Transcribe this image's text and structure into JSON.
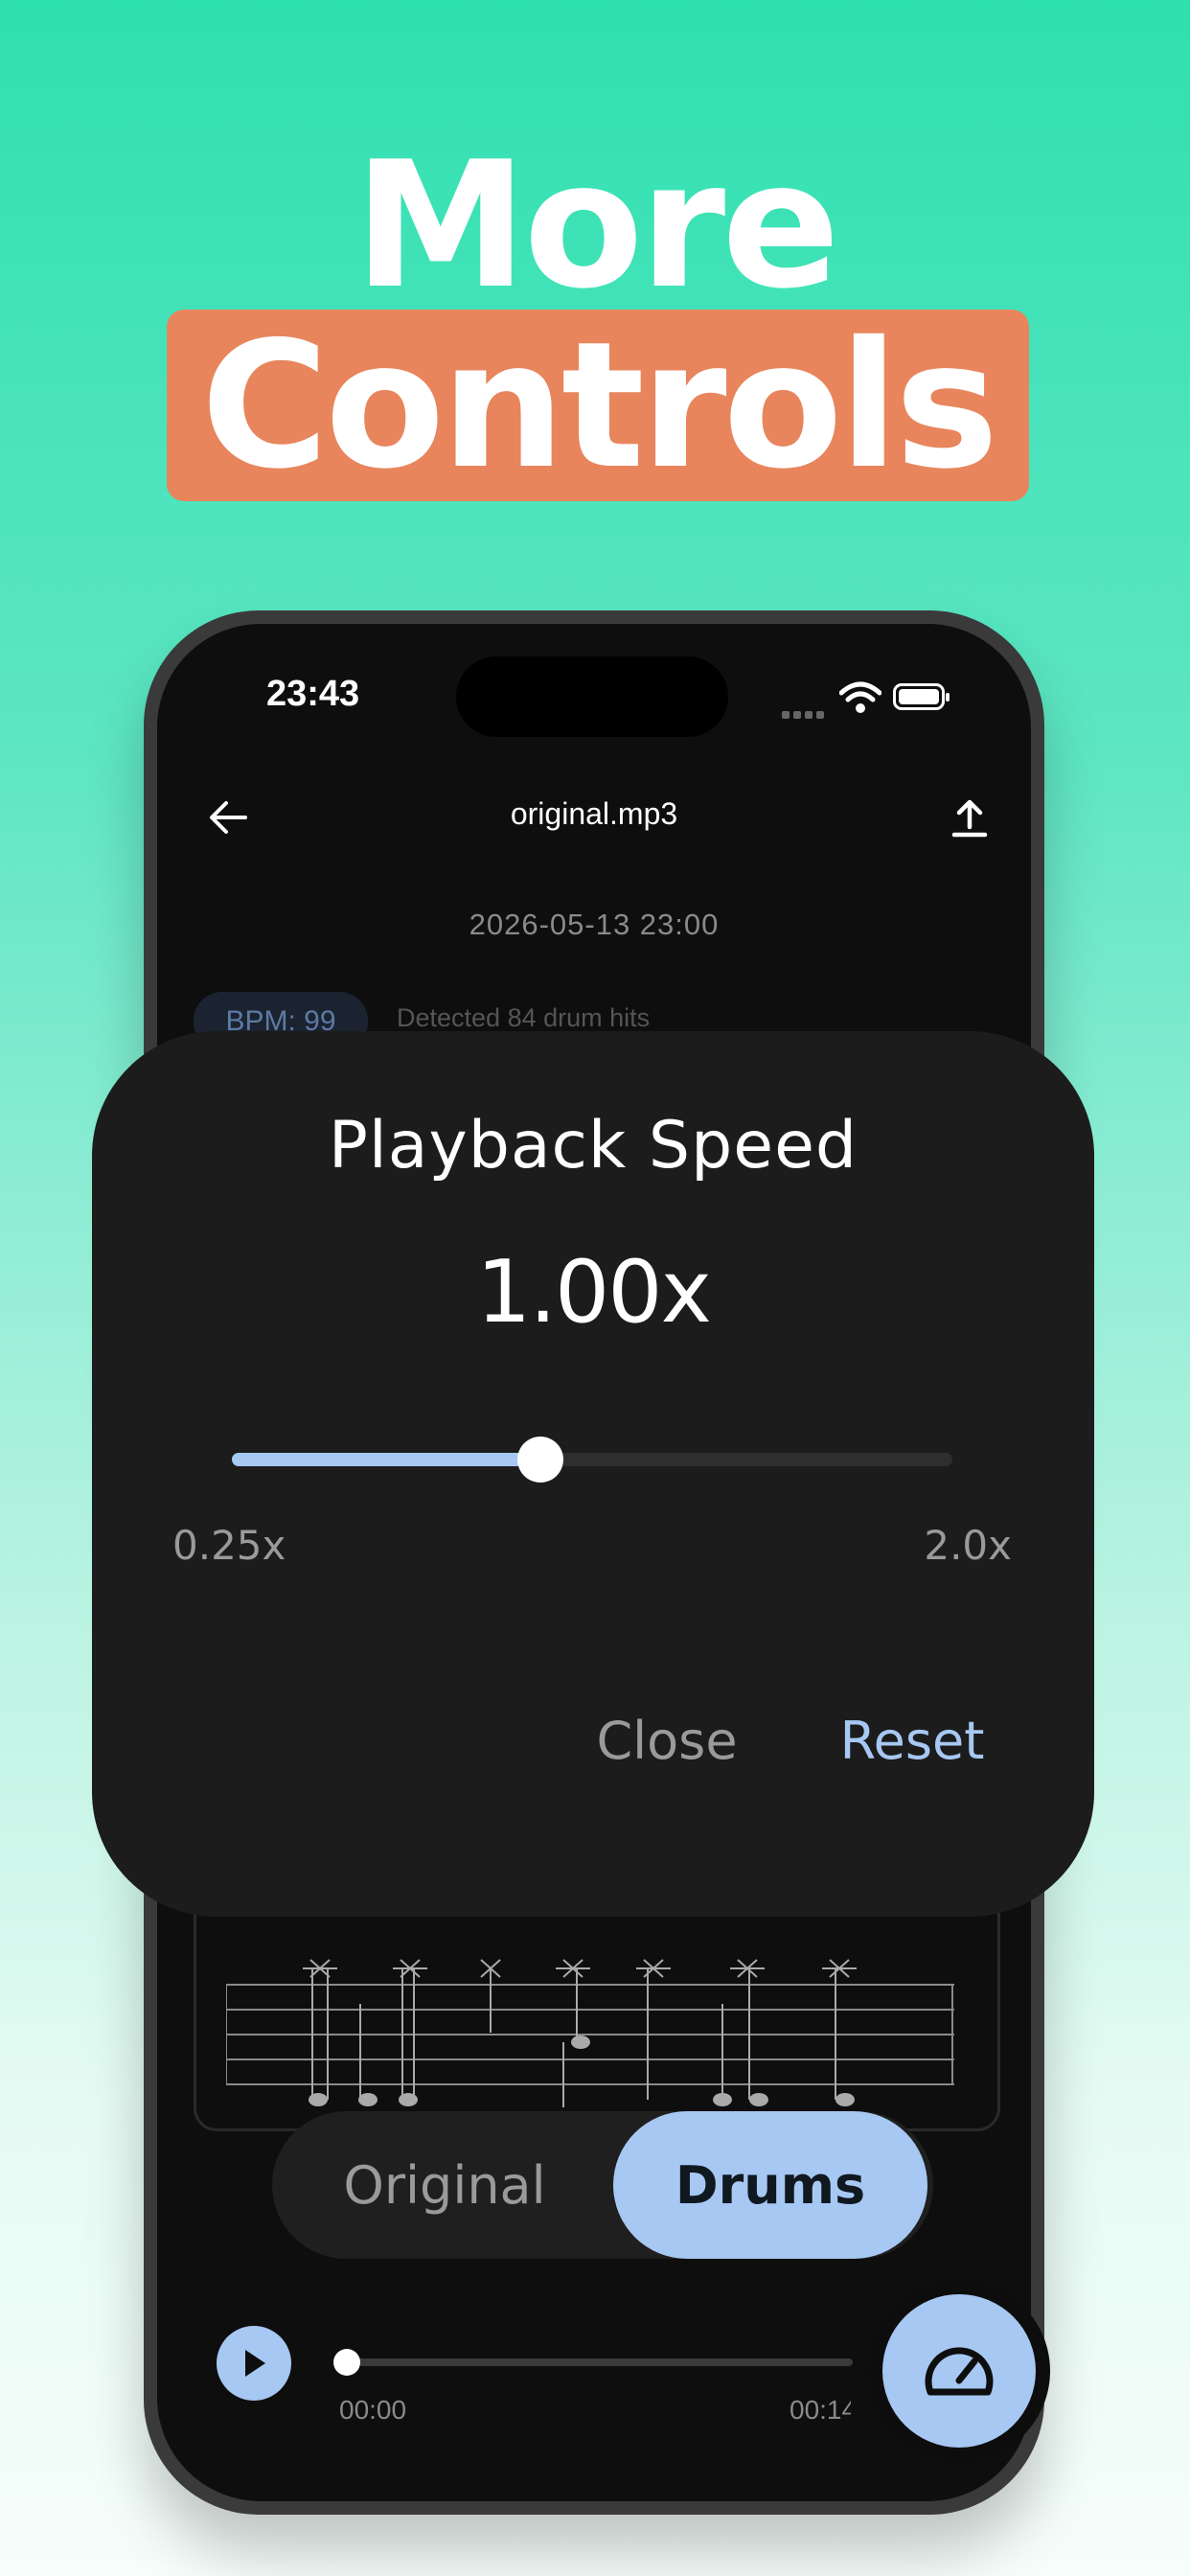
{
  "headline": {
    "line1": "More",
    "line2": "Controls"
  },
  "status_bar": {
    "time": "23:43"
  },
  "header": {
    "title": "original.mp3"
  },
  "recording": {
    "date": "2026-05-13 23:00",
    "bpm": "BPM: 99",
    "detected": "Detected 84 drum hits"
  },
  "mode_toggle": {
    "options": [
      "Original",
      "Drums"
    ],
    "selected": "Drums"
  },
  "player": {
    "current_time": "00:00",
    "total_time": "00:14",
    "progress": 0
  },
  "speed_dialog": {
    "title": "Playback Speed",
    "value_label": "1.00x",
    "min_label": "0.25x",
    "max_label": "2.0x",
    "min": 0.25,
    "max": 2.0,
    "value": 1.0,
    "close_label": "Close",
    "reset_label": "Reset"
  },
  "colors": {
    "accent": "#a6c8f2",
    "headline_box": "#e8855c",
    "background_top": "#2fe0b0"
  },
  "icons": {
    "back": "arrow-left-icon",
    "share": "upload-icon",
    "play": "play-icon",
    "speed": "speedometer-icon"
  }
}
